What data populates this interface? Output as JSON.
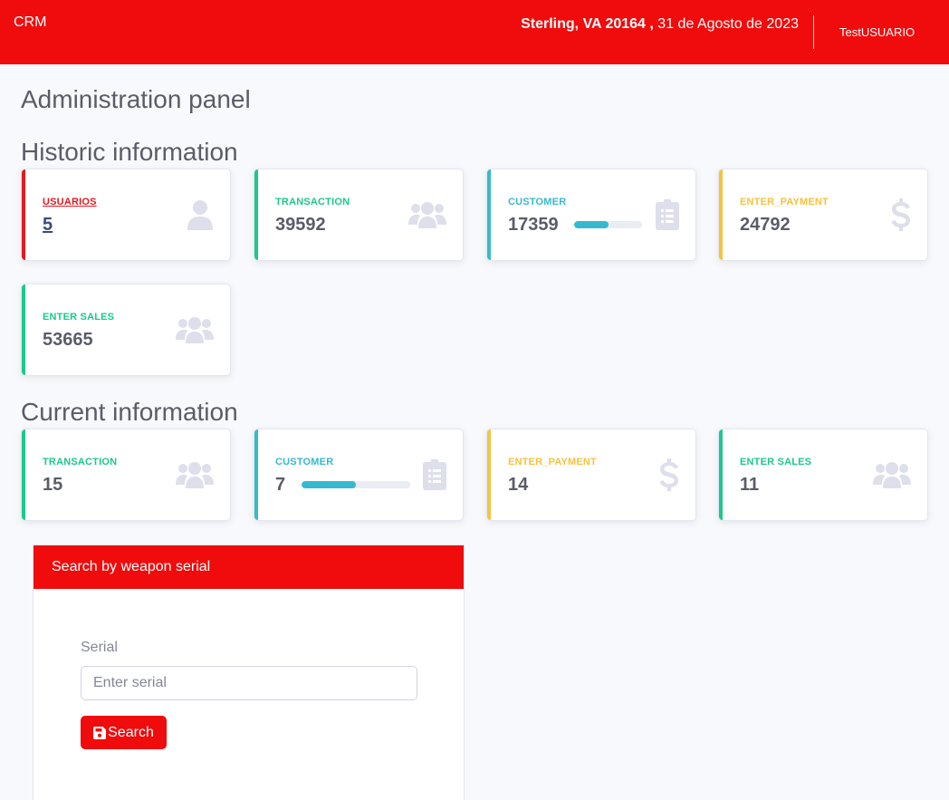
{
  "topbar": {
    "brand": "CRM",
    "location": "Sterling, VA 20164 ,",
    "date": "31 de Agosto de 2023",
    "username": "TestUSUARIO",
    "bg_color": "#f00c0c"
  },
  "page_title": "Administration panel",
  "historic": {
    "title": "Historic information",
    "cards": [
      {
        "label": "USUARIOS",
        "value": "5",
        "color": "#e2191f",
        "icon": "user-icon"
      },
      {
        "label": "TRANSACTION",
        "value": "39592",
        "color": "#1cc88a",
        "icon": "users-icon"
      },
      {
        "label": "CUSTOMER",
        "value": "17359",
        "color": "#36b9cc",
        "icon": "clipboard-list-icon",
        "progress": 0.5
      },
      {
        "label": "ENTER_PAYMENT",
        "value": "24792",
        "color": "#f6c23e",
        "icon": "dollar-icon"
      },
      {
        "label": "ENTER SALES",
        "value": "53665",
        "color": "#1cc88a",
        "icon": "users-icon"
      }
    ]
  },
  "current": {
    "title": "Current information",
    "cards": [
      {
        "label": "TRANSACTION",
        "value": "15",
        "color": "#1cc88a",
        "icon": "users-icon"
      },
      {
        "label": "CUSTOMER",
        "value": "7",
        "color": "#36b9cc",
        "icon": "clipboard-list-icon",
        "progress": 0.5
      },
      {
        "label": "ENTER_PAYMENT",
        "value": "14",
        "color": "#f6c23e",
        "icon": "dollar-icon"
      },
      {
        "label": "ENTER SALES",
        "value": "11",
        "color": "#1cc88a",
        "icon": "users-icon"
      }
    ]
  },
  "search": {
    "header": "Search by weapon serial",
    "field_label": "Serial",
    "placeholder": "Enter serial",
    "value": "",
    "button_label": "Search",
    "button_icon": "save-icon"
  }
}
